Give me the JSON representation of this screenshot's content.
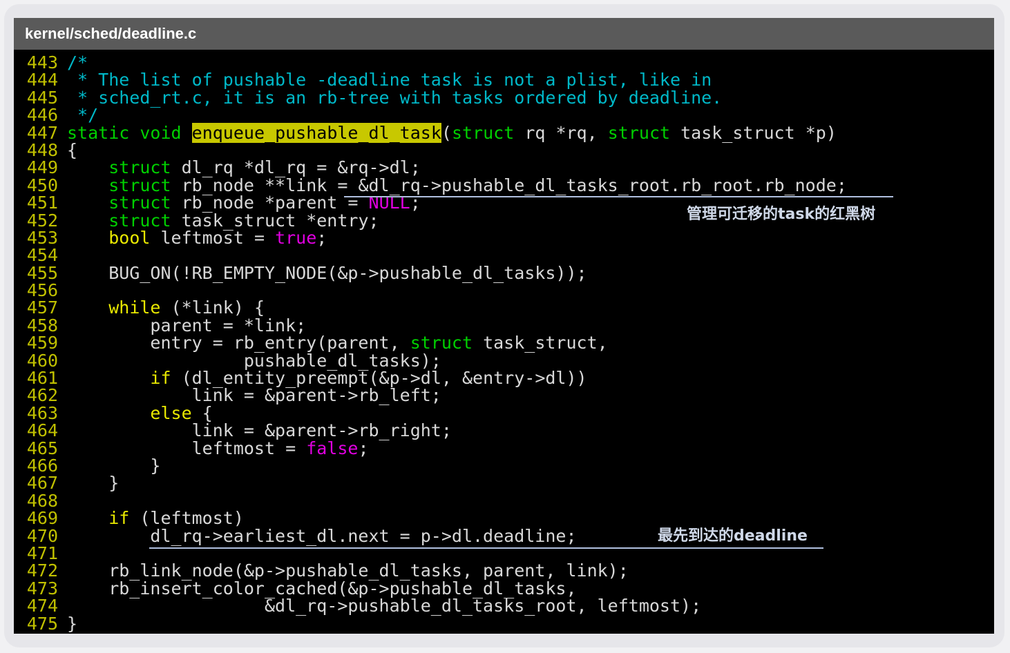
{
  "window": {
    "title": "kernel/sched/deadline.c"
  },
  "annotations": {
    "tree_note": "管理可迁移的task的红黑树",
    "deadline_note": "最先到达的deadline"
  },
  "code": {
    "lines": [
      {
        "n": "443",
        "segs": [
          [
            "cm",
            "/*"
          ]
        ]
      },
      {
        "n": "444",
        "segs": [
          [
            "cm",
            " * The list of pushable -deadline task is not a plist, like in"
          ]
        ]
      },
      {
        "n": "445",
        "segs": [
          [
            "cm",
            " * sched_rt.c, it is an rb-tree with tasks ordered by deadline."
          ]
        ]
      },
      {
        "n": "446",
        "segs": [
          [
            "cm",
            " */"
          ]
        ]
      },
      {
        "n": "447",
        "segs": [
          [
            "kw",
            "static"
          ],
          [
            "tx",
            " "
          ],
          [
            "kw",
            "void"
          ],
          [
            "tx",
            " "
          ],
          [
            "hl",
            "enqueue_pushable_dl_task"
          ],
          [
            "tx",
            "("
          ],
          [
            "kw",
            "struct"
          ],
          [
            "tx",
            " rq *rq, "
          ],
          [
            "kw",
            "struct"
          ],
          [
            "tx",
            " task_struct *p)"
          ]
        ]
      },
      {
        "n": "448",
        "segs": [
          [
            "tx",
            "{"
          ]
        ]
      },
      {
        "n": "449",
        "segs": [
          [
            "tx",
            "    "
          ],
          [
            "kw",
            "struct"
          ],
          [
            "tx",
            " dl_rq *dl_rq = &rq->dl;"
          ]
        ]
      },
      {
        "n": "450",
        "segs": [
          [
            "tx",
            "    "
          ],
          [
            "kw",
            "struct"
          ],
          [
            "tx",
            " rb_node **link = &dl_rq->pushable_dl_tasks_root.rb_root.rb_node;"
          ]
        ]
      },
      {
        "n": "451",
        "segs": [
          [
            "tx",
            "    "
          ],
          [
            "kw",
            "struct"
          ],
          [
            "tx",
            " rb_node *parent = "
          ],
          [
            "cst",
            "NULL"
          ],
          [
            "tx",
            ";"
          ]
        ]
      },
      {
        "n": "452",
        "segs": [
          [
            "tx",
            "    "
          ],
          [
            "kw",
            "struct"
          ],
          [
            "tx",
            " task_struct *entry;"
          ]
        ]
      },
      {
        "n": "453",
        "segs": [
          [
            "tx",
            "    "
          ],
          [
            "ctl",
            "bool"
          ],
          [
            "tx",
            " leftmost = "
          ],
          [
            "cst",
            "true"
          ],
          [
            "tx",
            ";"
          ]
        ]
      },
      {
        "n": "454",
        "segs": [
          [
            "tx",
            ""
          ]
        ]
      },
      {
        "n": "455",
        "segs": [
          [
            "tx",
            "    BUG_ON(!RB_EMPTY_NODE(&p->pushable_dl_tasks));"
          ]
        ]
      },
      {
        "n": "456",
        "segs": [
          [
            "tx",
            ""
          ]
        ]
      },
      {
        "n": "457",
        "segs": [
          [
            "tx",
            "    "
          ],
          [
            "ctl",
            "while"
          ],
          [
            "tx",
            " (*link) {"
          ]
        ]
      },
      {
        "n": "458",
        "segs": [
          [
            "tx",
            "        parent = *link;"
          ]
        ]
      },
      {
        "n": "459",
        "segs": [
          [
            "tx",
            "        entry = rb_entry(parent, "
          ],
          [
            "kw",
            "struct"
          ],
          [
            "tx",
            " task_struct,"
          ]
        ]
      },
      {
        "n": "460",
        "segs": [
          [
            "tx",
            "                 pushable_dl_tasks);"
          ]
        ]
      },
      {
        "n": "461",
        "segs": [
          [
            "tx",
            "        "
          ],
          [
            "ctl",
            "if"
          ],
          [
            "tx",
            " (dl_entity_preempt(&p->dl, &entry->dl))"
          ]
        ]
      },
      {
        "n": "462",
        "segs": [
          [
            "tx",
            "            link = &parent->rb_left;"
          ]
        ]
      },
      {
        "n": "463",
        "segs": [
          [
            "tx",
            "        "
          ],
          [
            "ctl",
            "else"
          ],
          [
            "tx",
            " {"
          ]
        ]
      },
      {
        "n": "464",
        "segs": [
          [
            "tx",
            "            link = &parent->rb_right;"
          ]
        ]
      },
      {
        "n": "465",
        "segs": [
          [
            "tx",
            "            leftmost = "
          ],
          [
            "cst",
            "false"
          ],
          [
            "tx",
            ";"
          ]
        ]
      },
      {
        "n": "466",
        "segs": [
          [
            "tx",
            "        }"
          ]
        ]
      },
      {
        "n": "467",
        "segs": [
          [
            "tx",
            "    }"
          ]
        ]
      },
      {
        "n": "468",
        "segs": [
          [
            "tx",
            ""
          ]
        ]
      },
      {
        "n": "469",
        "segs": [
          [
            "tx",
            "    "
          ],
          [
            "ctl",
            "if"
          ],
          [
            "tx",
            " (leftmost)"
          ]
        ]
      },
      {
        "n": "470",
        "segs": [
          [
            "tx",
            "        dl_rq->earliest_dl.next = p->dl.deadline;"
          ]
        ]
      },
      {
        "n": "471",
        "segs": [
          [
            "tx",
            ""
          ]
        ]
      },
      {
        "n": "472",
        "segs": [
          [
            "tx",
            "    rb_link_node(&p->pushable_dl_tasks, parent, link);"
          ]
        ]
      },
      {
        "n": "473",
        "segs": [
          [
            "tx",
            "    rb_insert_color_cached(&p->pushable_dl_tasks,"
          ]
        ]
      },
      {
        "n": "474",
        "segs": [
          [
            "tx",
            "                   &dl_rq->pushable_dl_tasks_root, leftmost);"
          ]
        ]
      },
      {
        "n": "475",
        "segs": [
          [
            "tx",
            "}"
          ]
        ]
      }
    ]
  }
}
